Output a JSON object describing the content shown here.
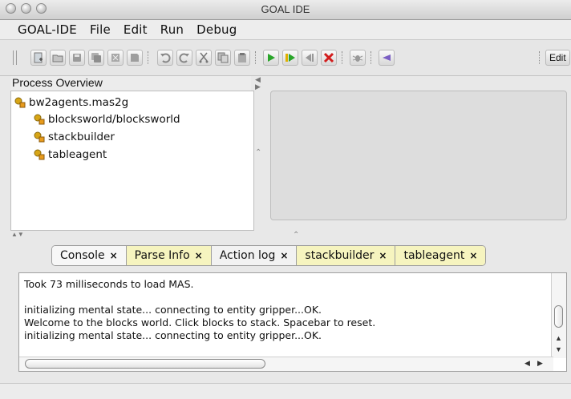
{
  "window": {
    "title": "GOAL IDE"
  },
  "menu": [
    "GOAL-IDE",
    "File",
    "Edit",
    "Run",
    "Debug"
  ],
  "toolbar": {
    "edit_label": "Edit",
    "icons": [
      "new-file-icon",
      "open-folder-icon",
      "save-icon",
      "save-all-icon",
      "close-file-icon",
      "close-all-icon",
      "undo-icon",
      "redo-icon",
      "cut-icon",
      "copy-icon",
      "paste-icon",
      "run-icon",
      "step-icon",
      "back-icon",
      "kill-icon",
      "debug-bug-icon",
      "breakpoint-icon"
    ]
  },
  "process_overview": {
    "header": "Process Overview",
    "root": "bw2agents.mas2g",
    "children": [
      "blocksworld/blocksworld",
      "stackbuilder",
      "tableagent"
    ]
  },
  "tabs": [
    {
      "label": "Console",
      "close": "×",
      "style": "active"
    },
    {
      "label": "Parse Info",
      "close": "×",
      "style": "alt"
    },
    {
      "label": "Action log",
      "close": "×",
      "style": "normal"
    },
    {
      "label": "stackbuilder",
      "close": "×",
      "style": "alt"
    },
    {
      "label": "tableagent",
      "close": "×",
      "style": "alt"
    }
  ],
  "console": {
    "lines": [
      "Took 73 milliseconds to load MAS.",
      "",
      "initializing mental state... connecting to entity gripper...OK.",
      "Welcome to the blocks world. Click blocks to stack. Spacebar to reset.",
      "initializing mental state... connecting to entity gripper...OK."
    ]
  },
  "colors": {
    "tab_alt": "#f6f4bf",
    "run_green": "#2aa52a",
    "kill_red": "#d21d1d",
    "breakpoint_purple": "#7b5fc4"
  }
}
